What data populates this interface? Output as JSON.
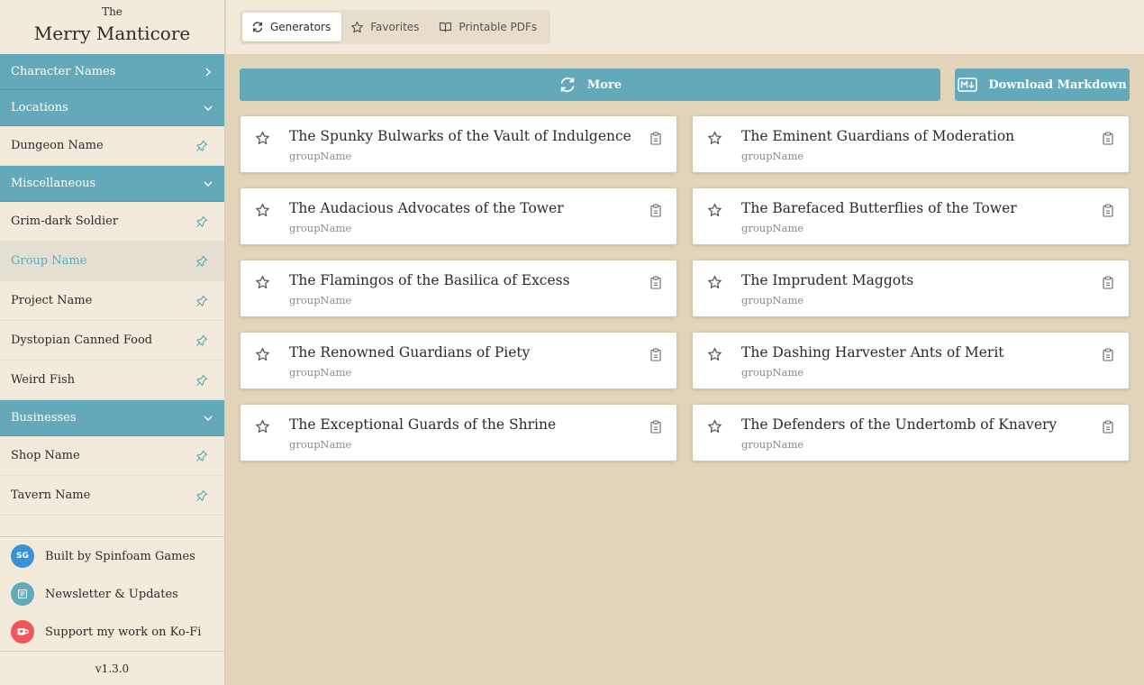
{
  "brand": {
    "small": "The",
    "title": "Merry Manticore"
  },
  "sidebar": {
    "sections": [
      {
        "label": "Character Names",
        "expanded": false,
        "items": []
      },
      {
        "label": "Locations",
        "expanded": true,
        "items": [
          "Dungeon Name"
        ]
      },
      {
        "label": "Miscellaneous",
        "expanded": true,
        "items": [
          "Grim-dark Soldier",
          "Group Name",
          "Project Name",
          "Dystopian Canned Food",
          "Weird Fish"
        ]
      },
      {
        "label": "Businesses",
        "expanded": true,
        "items": [
          "Shop Name",
          "Tavern Name"
        ]
      }
    ],
    "active_item": "Group Name",
    "footer": [
      {
        "label": "Built by Spinfoam Games",
        "badge": "SG",
        "color": "#3b8fd9"
      },
      {
        "label": "Newsletter & Updates",
        "icon": "newspaper-icon",
        "color": "#63a9b9"
      },
      {
        "label": "Support my work on Ko-Fi",
        "icon": "kofi-cup-icon",
        "color": "#f0575a"
      }
    ],
    "version": "v1.3.0"
  },
  "tabs": [
    {
      "label": "Generators",
      "icon": "refresh-icon",
      "active": true
    },
    {
      "label": "Favorites",
      "icon": "star-icon",
      "active": false
    },
    {
      "label": "Printable PDFs",
      "icon": "book-icon",
      "active": false
    }
  ],
  "actions": {
    "more": "More",
    "download": "Download Markdown"
  },
  "results": [
    {
      "title": "The Spunky Bulwarks of the Vault of Indulgence",
      "sub": "groupName"
    },
    {
      "title": "The Eminent Guardians of Moderation",
      "sub": "groupName"
    },
    {
      "title": "The Audacious Advocates of the Tower",
      "sub": "groupName"
    },
    {
      "title": "The Barefaced Butterflies of the Tower",
      "sub": "groupName"
    },
    {
      "title": "The Flamingos of the Basilica of Excess",
      "sub": "groupName"
    },
    {
      "title": "The Imprudent Maggots",
      "sub": "groupName"
    },
    {
      "title": "The Renowned Guardians of Piety",
      "sub": "groupName"
    },
    {
      "title": "The Dashing Harvester Ants of Merit",
      "sub": "groupName"
    },
    {
      "title": "The Exceptional Guards of the Shrine",
      "sub": "groupName"
    },
    {
      "title": "The Defenders of the Undertomb of Knavery",
      "sub": "groupName"
    }
  ],
  "colors": {
    "accent": "#63a9b9",
    "sidebar_bg": "#f2eadb",
    "main_bg": "#e1d4ba"
  }
}
